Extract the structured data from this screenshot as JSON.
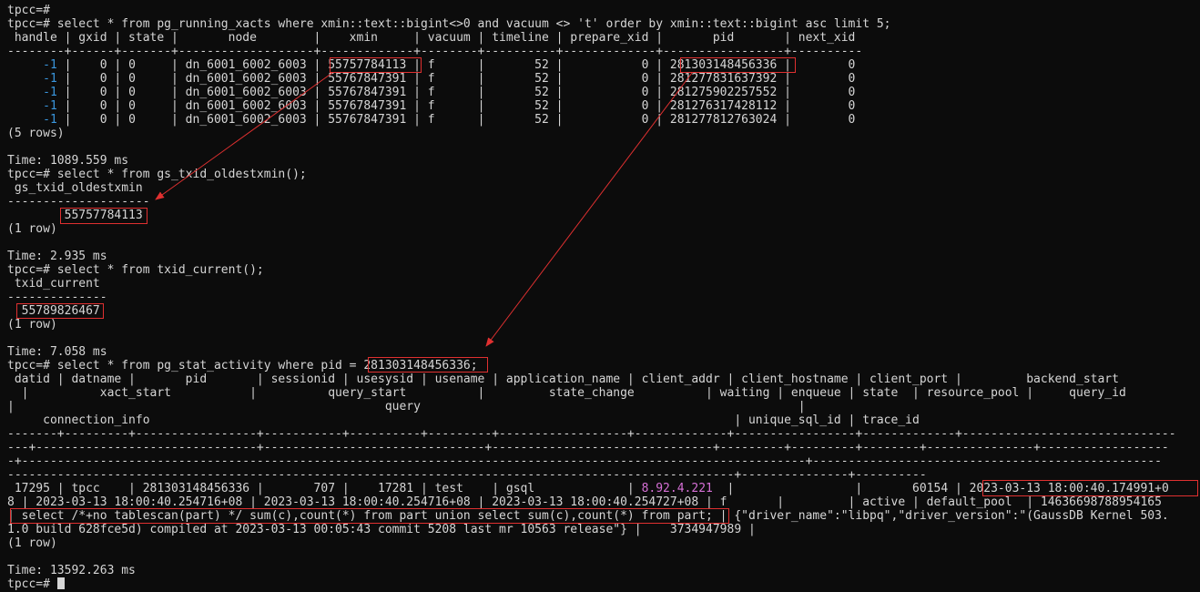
{
  "terminal": {
    "lines": [
      "tpcc=#",
      "tpcc=# select * from pg_running_xacts where xmin::text::bigint<>0 and vacuum <> 't' order by xmin::text::bigint asc limit 5;",
      " handle | gxid | state |       node        |    xmin     | vacuum | timeline | prepare_xid |       pid       | next_xid",
      "--------+------+-------+-------------------+-------------+--------+----------+-------------+-----------------+----------",
      "     -1 |    0 | 0     | dn_6001_6002_6003 | 55757784113 | f      |       52 |           0 | 281303148456336 |        0",
      "     -1 |    0 | 0     | dn_6001_6002_6003 | 55767847391 | f      |       52 |           0 | 281277831637392 |        0",
      "     -1 |    0 | 0     | dn_6001_6002_6003 | 55767847391 | f      |       52 |           0 | 281275902257552 |        0",
      "     -1 |    0 | 0     | dn_6001_6002_6003 | 55767847391 | f      |       52 |           0 | 281276317428112 |        0",
      "     -1 |    0 | 0     | dn_6001_6002_6003 | 55767847391 | f      |       52 |           0 | 281277812763024 |        0",
      "(5 rows)",
      "",
      "Time: 1089.559 ms",
      "tpcc=# select * from gs_txid_oldestxmin();",
      " gs_txid_oldestxmin",
      "--------------------",
      "        55757784113",
      "(1 row)",
      "",
      "Time: 2.935 ms",
      "tpcc=# select * from txid_current();",
      " txid_current",
      "--------------",
      "  55789826467",
      "(1 row)",
      "",
      "Time: 7.058 ms",
      "tpcc=# select * from pg_stat_activity where pid = 281303148456336;",
      " datid | datname |       pid       | sessionid | usesysid | usename | application_name | client_addr | client_hostname | client_port |         backend_start",
      "  |          xact_start           |          query_start          |         state_change          | waiting | enqueue | state  | resource_pool |     query_id",
      "|                                                    query                                                     |",
      "     connection_info                                                                                  | unique_sql_id | trace_id",
      "-------+---------+-----------------+-----------+----------+---------+------------------+-------------+-----------------+-------------+------------------------------",
      "---+-------------------------------+-------------------------------+-------------------------------+---------+---------+--------+---------------+------------------",
      "-+--------------------------------------------------------------------------------------------------------------+-------------------------------------------------",
      "------------------------------------------------------------------------------------------------------+---------------+----------",
      " 17295 | tpcc    | 281303148456336 |       707 |    17281 | test    | gsql             | 8.92.4.221  |                 |       60154 | 2023-03-13 18:00:40.174991+0",
      "8 | 2023-03-13 18:00:40.254716+08 | 2023-03-13 18:00:40.254716+08 | 2023-03-13 18:00:40.254727+08 | f       |         | active | default_pool  | 14636698788954165",
      "| select /*+no tablescan(part) */ sum(c),count(*) from part union select sum(c),count(*) from part; | {\"driver_name\":\"libpq\",\"driver_version\":\"(GaussDB Kernel 503.",
      "1.0 build 628fce5d) compiled at 2023-03-13 00:05:43 commit 5208 last mr 10563 release\"} |    3734947989 |",
      "(1 row)",
      "",
      "Time: 13592.263 ms",
      "tpcc=# "
    ],
    "client_addr_value": "8.92.4.221",
    "colors": {
      "background": "#0c0c0c",
      "text": "#d6d6d6",
      "handle_value": "#3a96dd",
      "client_addr_value": "#d670d6",
      "highlight_box": "#e03030",
      "arrow": "#e03030"
    }
  }
}
